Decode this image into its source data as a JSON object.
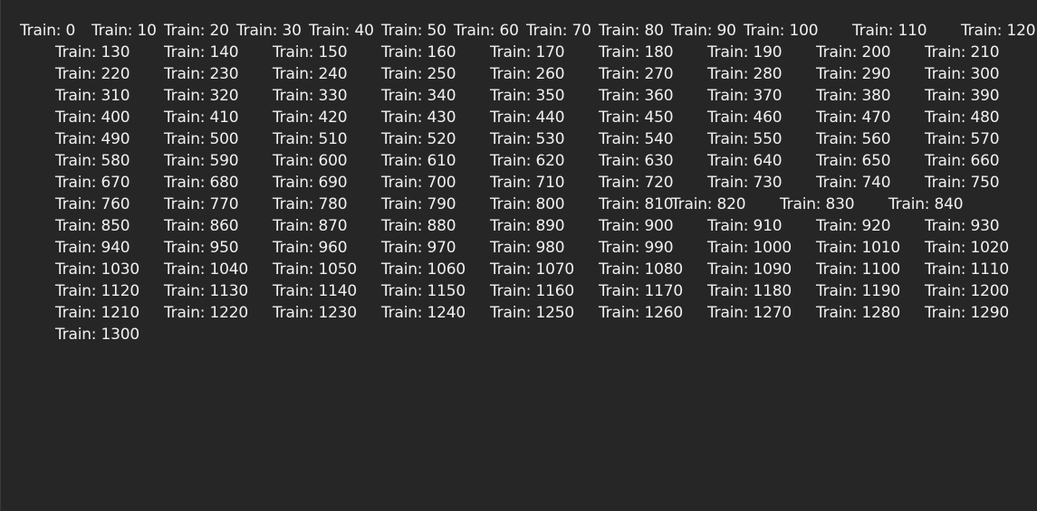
{
  "console": {
    "lines": [
      "Train: 0",
      "Train: 10",
      "Train: 20",
      "Train: 30",
      "Train: 40",
      "Train: 50",
      "Train: 60",
      "Train: 70",
      "Train: 80",
      "Train: 90",
      "Train: 100",
      "Train: 110",
      "Train: 120",
      "Train: 130",
      "Train: 140",
      "Train: 150",
      "Train: 160",
      "Train: 170",
      "Train: 180",
      "Train: 190",
      "Train: 200",
      "Train: 210",
      "Train: 220",
      "Train: 230",
      "Train: 240",
      "Train: 250",
      "Train: 260",
      "Train: 270",
      "Train: 280",
      "Train: 290",
      "Train: 300",
      "Train: 310",
      "Train: 320",
      "Train: 330",
      "Train: 340",
      "Train: 350",
      "Train: 360",
      "Train: 370",
      "Train: 380",
      "Train: 390",
      "Train: 400",
      "Train: 410",
      "Train: 420",
      "Train: 430",
      "Train: 440",
      "Train: 450",
      "Train: 460",
      "Train: 470",
      "Train: 480",
      "Train: 490",
      "Train: 500",
      "Train: 510",
      "Train: 520",
      "Train: 530",
      "Train: 540",
      "Train: 550",
      "Train: 560",
      "Train: 570",
      "Train: 580",
      "Train: 590",
      "Train: 600",
      "Train: 610",
      "Train: 620",
      "Train: 630",
      "Train: 640",
      "Train: 650",
      "Train: 660",
      "Train: 670",
      "Train: 680",
      "Train: 690",
      "Train: 700",
      "Train: 710",
      "Train: 720",
      "Train: 730",
      "Train: 740",
      "Train: 750",
      "Train: 760",
      "Train: 770",
      "Train: 780",
      "Train: 790",
      "Train: 800",
      "Train: 810",
      "Train: 820",
      "Train: 830",
      "Train: 840",
      "Train: 850",
      "Train: 860",
      "Train: 870",
      "Train: 880",
      "Train: 890",
      "Train: 900",
      "Train: 910",
      "Train: 920",
      "Train: 930",
      "Train: 940",
      "Train: 950",
      "Train: 960",
      "Train: 970",
      "Train: 980",
      "Train: 990",
      "Train: 1000",
      "Train: 1010",
      "Train: 1020",
      "Train: 1030",
      "Train: 1040",
      "Train: 1050",
      "Train: 1060",
      "Train: 1070",
      "Train: 1080",
      "Train: 1090",
      "Train: 1100",
      "Train: 1110",
      "Train: 1120",
      "Train: 1130",
      "Train: 1140",
      "Train: 1150",
      "Train: 1160",
      "Train: 1170",
      "Train: 1180",
      "Train: 1190",
      "Train: 1200",
      "Train: 1210",
      "Train: 1220",
      "Train: 1230",
      "Train: 1240",
      "Train: 1250",
      "Train: 1260",
      "Train: 1270",
      "Train: 1280",
      "Train: 1290",
      "Train: 1300"
    ]
  },
  "colors": {
    "background": "#262626",
    "text": "#f0f0f0"
  }
}
